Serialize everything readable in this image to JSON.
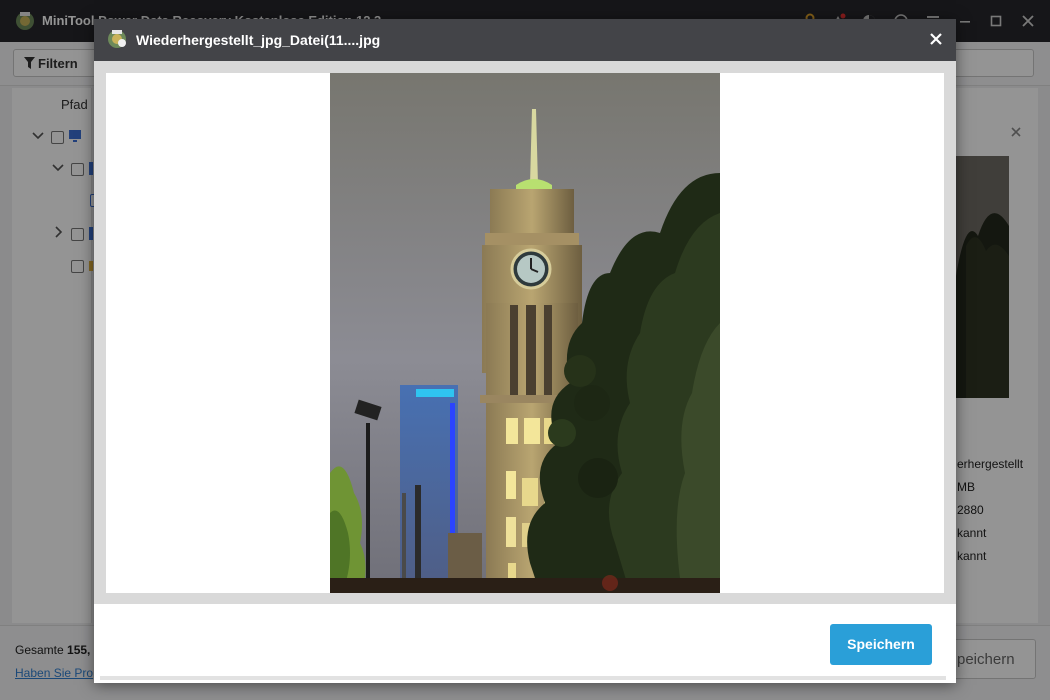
{
  "app": {
    "title": "MiniTool Power Data Recovery Kostenlose Edition 12.3",
    "toolbar": {
      "filter_label": "Filtern"
    },
    "left_panel": {
      "path_header": "Pfad"
    },
    "preview_panel": {
      "info_values": [
        "erhergestellt",
        "MB",
        "2880",
        "kannt",
        "kannt"
      ]
    },
    "footer": {
      "total_label": "Gesamte ",
      "total_value": "155,",
      "help_link": "Haben Sie Pro",
      "save_button": "peichern"
    }
  },
  "dialog": {
    "title": "Wiederhergestellt_jpg_Datei(11....jpg",
    "save_button": "Speichern"
  },
  "colors": {
    "accent": "#2a9fd8",
    "titlebar": "#26272b",
    "dialog_titlebar": "#434448",
    "link": "#2f7fd1"
  },
  "icons": {
    "app_logo": "minitool-logo-icon",
    "dialog_logo": "minitool-logo-icon",
    "dialog_close": "close-icon",
    "filter": "funnel-icon"
  }
}
